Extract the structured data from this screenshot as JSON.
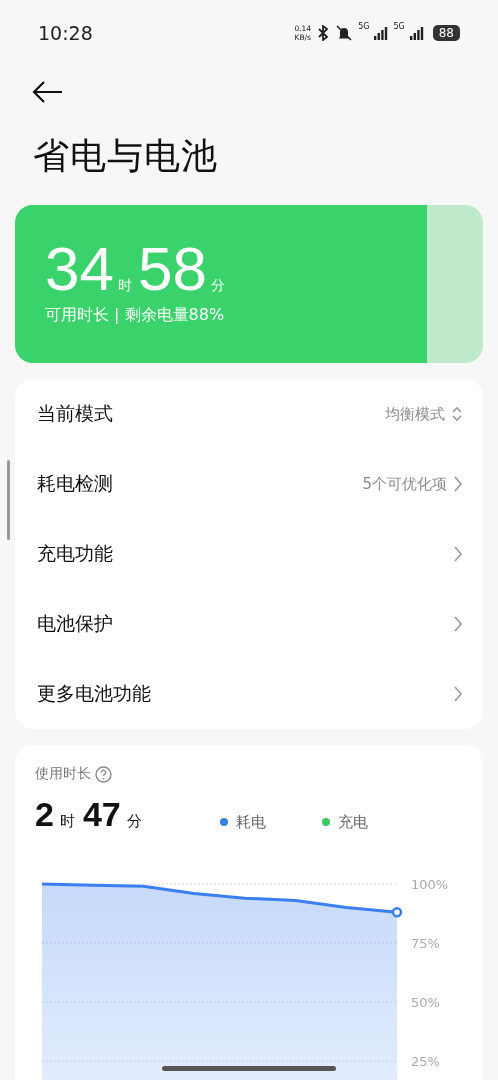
{
  "status_bar": {
    "time": "10:28",
    "net_speed": "0.14",
    "net_unit": "KB/s",
    "sim_labels": [
      "5G",
      "5G"
    ],
    "battery": "88"
  },
  "title": "省电与电池",
  "battery_card": {
    "hours": "34",
    "hours_unit": "时",
    "minutes": "58",
    "minutes_unit": "分",
    "caption": "可用时长 | 剩余电量88%",
    "level": 0.88
  },
  "settings": [
    {
      "label": "当前模式",
      "value": "均衡模式",
      "kind": "select"
    },
    {
      "label": "耗电检测",
      "value": "5个可优化项",
      "kind": "link"
    },
    {
      "label": "充电功能",
      "kind": "link"
    },
    {
      "label": "电池保护",
      "kind": "link"
    },
    {
      "label": "更多电池功能",
      "kind": "link"
    }
  ],
  "usage": {
    "title": "使用时长",
    "hours": "2",
    "hours_unit": "时",
    "minutes": "47",
    "minutes_unit": "分",
    "chart_data": {
      "type": "area",
      "grid": true,
      "ylim": [
        0,
        100
      ],
      "yticks": [
        {
          "value": 100,
          "label": "100%"
        },
        {
          "value": 75,
          "label": "75%"
        },
        {
          "value": 50,
          "label": "50%"
        },
        {
          "value": 25,
          "label": "25%"
        }
      ],
      "series": [
        {
          "name": "耗电",
          "color": "#3b7ff0",
          "values": [
            100,
            99.5,
            99,
            96,
            94,
            93,
            90,
            88
          ]
        },
        {
          "name": "充电",
          "color": "#3cc864",
          "values": [
            null,
            null,
            null,
            null,
            null,
            null,
            null,
            null
          ]
        }
      ]
    }
  }
}
